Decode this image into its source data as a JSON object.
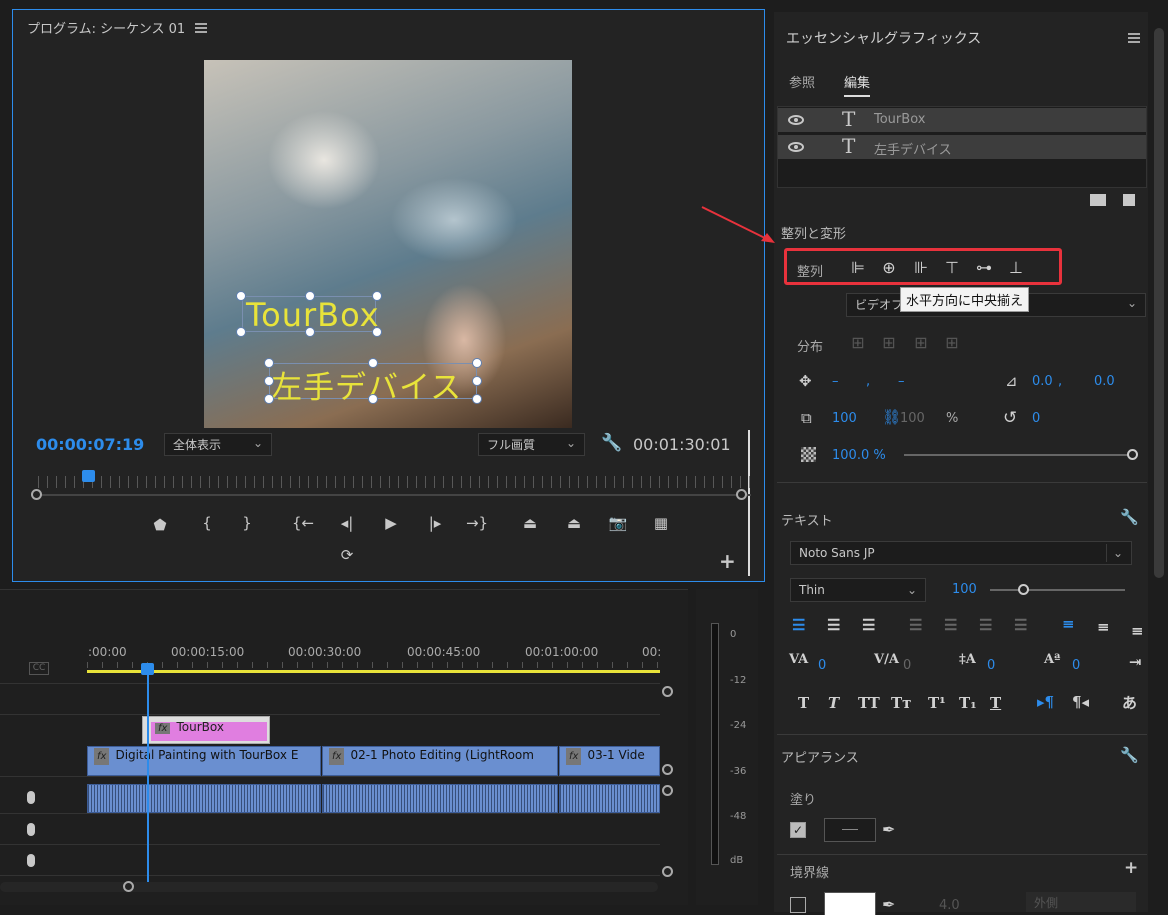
{
  "program": {
    "title": "プログラム: シーケンス 01",
    "current_time": "00:00:07:19",
    "zoom": "全体表示",
    "quality": "フル画質",
    "duration": "00:01:30:01",
    "overlay_text_1": "TourBox",
    "overlay_text_2": "左手デバイス"
  },
  "timeline": {
    "ruler": [
      ":00:00",
      "00:00:15:00",
      "00:00:30:00",
      "00:00:45:00",
      "00:01:00:00",
      "00:"
    ],
    "graphic_clip": "TourBox",
    "fx_label": "fx",
    "clips": [
      "Digital Painting with TourBox E",
      "02-1 Photo Editing (LightRoom",
      "03-1 Vide"
    ],
    "cc_label": "CC",
    "playhead_fraction": 0.105
  },
  "meter": {
    "labels": [
      "0",
      "-12",
      "-24",
      "-36",
      "-48",
      "dB"
    ]
  },
  "panel": {
    "title": "エッセンシャルグラフィックス",
    "tabs": [
      "参照",
      "編集"
    ],
    "layers": [
      {
        "name": "TourBox"
      },
      {
        "name": "左手デバイス"
      }
    ],
    "align_section": "整列と変形",
    "align_label": "整列",
    "tooltip": "水平方向に中央揃え",
    "align_to": "ビデオフ",
    "distribute_label": "分布",
    "position_x": "–",
    "position_comma": ",",
    "position_y": "–",
    "anchor_x": "0.0",
    "anchor_comma": ",",
    "anchor_y": "0.0",
    "scale": "100",
    "scale_locked": "100",
    "percent": "%",
    "rotation": "0",
    "opacity": "100.0 %",
    "text_section": "テキスト",
    "font": "Noto Sans JP",
    "font_style": "Thin",
    "font_size": "100",
    "tracking": "0",
    "kerning": "0",
    "leading": "0",
    "baseline": "0",
    "appearance_section": "アピアランス",
    "fill_label": "塗り",
    "stroke_label": "境界線",
    "stroke_width": "4.0",
    "stroke_position": "外側"
  },
  "colors": {
    "accent": "#2d8ceb",
    "highlight_red": "#e8323c",
    "overlay_yellow": "#e8e33a",
    "graphic_clip": "#e07ee0",
    "video_clip": "#6a8fd0"
  }
}
